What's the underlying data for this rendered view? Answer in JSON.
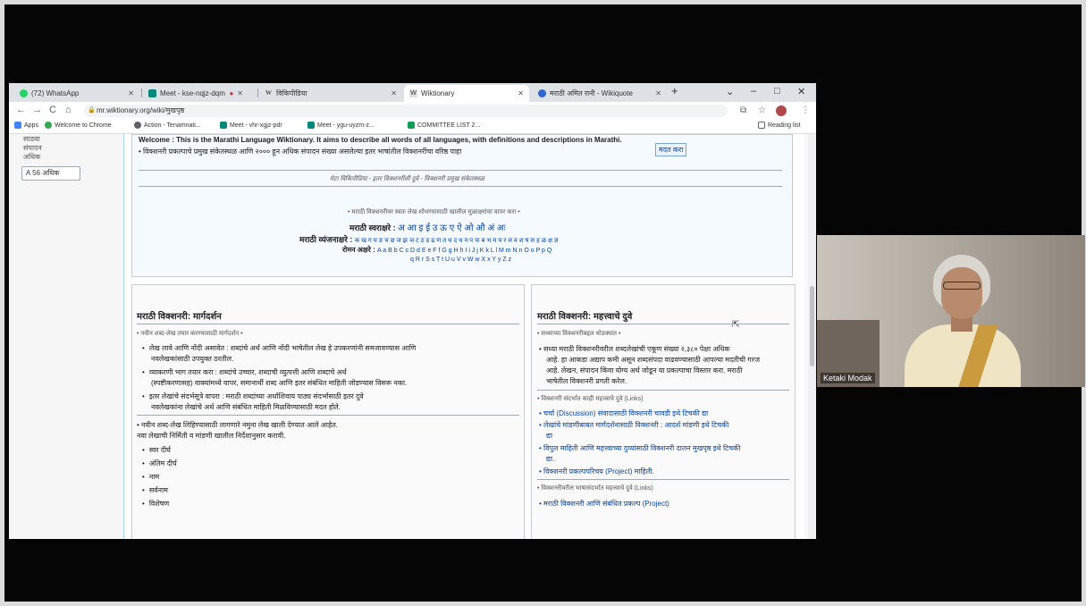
{
  "browser": {
    "tabs": [
      {
        "label": "(72) WhatsApp",
        "icon": "whatsapp-icon",
        "color": "#25d366"
      },
      {
        "label": "Meet - kse-nqjz-dqm",
        "icon": "meet-icon",
        "color": "#00897b"
      },
      {
        "label": "",
        "icon": "recording-icon",
        "color": "#d93025"
      },
      {
        "label": "विकिपीडिया",
        "icon": "wikipedia-icon",
        "color": "#555555"
      },
      {
        "label": "Wiktionary",
        "icon": "wiktionary-icon",
        "color": "#555555"
      },
      {
        "label": "मराठी अमित रानी - Wikiquote",
        "icon": "wikiquote-icon",
        "color": "#3366cc"
      }
    ],
    "new_tab": "+",
    "window_controls": {
      "dropdown": "⌄",
      "minimize": "–",
      "maximize": "□",
      "close": "✕"
    },
    "nav": {
      "back": "←",
      "forward": "→",
      "reload": "C",
      "home": "⌂"
    },
    "url": "mr.wiktionary.org/wiki/मुखपृष्ठ",
    "bookmarks": [
      {
        "label": "Apps",
        "icon": "apps-grid-icon",
        "color": "#4285f4"
      },
      {
        "label": "Welcome to Chrome",
        "icon": "chrome-icon",
        "color": "#34a853"
      },
      {
        "label": "Action - Tenamnati...",
        "icon": "bookmark-icon",
        "color": "#5f6368"
      },
      {
        "label": "Meet - vhr-xgjz-pdr",
        "icon": "meet-icon",
        "color": "#00897b"
      },
      {
        "label": "Meet - ygu-uyzm-z...",
        "icon": "meet-icon",
        "color": "#00897b"
      },
      {
        "label": "COMMITTEE LIST 2...",
        "icon": "sheets-icon",
        "color": "#0f9d58"
      }
    ],
    "reading_list": "Reading list"
  },
  "leftnav": {
    "items": [
      "साठवा",
      "संपादन",
      "अधिक"
    ],
    "lang_button": "A 56 अधिक"
  },
  "page": {
    "welcome_line": "Welcome : This is the Marathi Language Wiktionary. It aims to describe all words of all languages, with definitions and descriptions in Marathi.",
    "intro_line": "• विक्शनरी प्रकल्पाचे प्रमुख संकेतस्थळ आणि २००० हून अधिक संपादन संख्या असलेल्या इतर भाषांतील विक्शनरींचा वरिष्ठ पाहा",
    "cta": "मदत करा",
    "sister_line": "मेटा विकिपीडिया - इतर विक्शनरींशी दुवे - विक्शनरी प्रमुख संकेतस्थळ",
    "font_note": "• मराठी विक्शनरीवर स्वतः लेख शोधण्यासाठी खालील मुळाक्षरांचा वापर करा •",
    "vowels_label": "मराठी स्वराक्षरे :",
    "vowels": "अ आ इ ई उ ऊ ए ऐ ओ औ अं अः",
    "consonants_label": "मराठी व्यंजनाक्षरे :",
    "consonants": "क ख ग घ ङ च छ ज झ ञ ट ठ ड ढ ण त थ द ध न प फ ब भ म य र ल व श ष स ह ळ क्ष ज्ञ",
    "roman_label": "रोमन अक्षरे :",
    "roman_line1": "A a B b C c D d E e F f G g H h I i J j K k L l M m N n O o P p Q",
    "roman_line2": "q R r S s T t U u V v W w X x Y y Z z"
  },
  "left_section": {
    "title": "मराठी विक्शनरी: मार्गदर्शन",
    "subtitle": "• नवीन शब्द-लेख तयार करण्यासाठी मार्गदर्शन •",
    "bullets": [
      "लेख लावे आणि नोंदी असावेत : शब्दांचे अर्थ आणि नोंदी भाषेतील लेख हे उपकरणांनी समजावण्यास आणि",
      "नवलेखकांसाठी उपयुक्त ठरतील.",
      "व्याकरणी भाग तयार करा : शब्दांचे उच्चार, शब्दाची व्युत्पत्ती आणि शब्दाचे अर्थ",
      "(स्पष्टीकरणासह) वाक्यांमध्ये वापर, समानार्थी शब्द आणि इतर संबंधित माहिती जोडण्यास विसरू नका.",
      "इतर लेखांचे संदर्भसूत्रे वापरा : मराठी शब्दांच्या अर्थाशिवाय पाठ्य संदर्भासाठी इतर दुवे",
      "नवलेखकांना लेखांचे अर्थ आणि संबंधित माहिती मिळविण्यासाठी मदत होते."
    ],
    "note1": "• नवीन शब्द-लेख लिहिण्यासाठी लागणारे नमुना लेख खाली देण्यात आले आहेत.",
    "note2": "नवा लेखाची निर्मिती व मांडणी खालील निर्देशानुसार करावी.",
    "list": [
      "स्वर दीर्घ",
      "अंतिम दीर्घ",
      "नाम",
      "सर्वनाम",
      "विशेषण"
    ]
  },
  "right_section": {
    "title": "मराठी विक्शनरी: महत्त्वाचे दुवे",
    "subtitle": "• सध्याच्या विक्शनरीबद्दल थोडक्यात •",
    "para": [
      "• सध्या मराठी विक्शनरीवरील शब्दलेखांची एकूण संख्या २,३८० पेक्षा अधिक",
      "आहे. हा आकडा अद्याप कमी असून शब्दसंपदा वाढवण्यासाठी आपल्या मदतीची गरज",
      "आहे. लेखन, संपादन किंवा योग्य अर्थ जोडून या प्रकल्पाचा विस्तार करा. मराठी",
      "भाषेतील विक्शनरी प्रगती करेल."
    ],
    "links_head": "• विक्शनरी संदर्भात काही महत्त्वाचे दुवे (Links)",
    "links": [
      "• चर्चा (Discussion) संवादासाठी विक्शनरी चावडी इथे टिचकी द्या",
      "• लेखांचे मांडणीबाबत मार्गदर्शनासाठी विक्शनरी : आदर्श मांडणी इथे टिचकी",
      "द्या",
      "• विपुल माहिती आणि महत्त्वाच्या दुव्यांसाठी विक्शनरी दालन मुखपृष्ठ इथे टिचकी",
      "द्या.",
      "• विक्शनरी प्रकल्पपरिचय (Project) माहिती."
    ],
    "links_head2": "• विक्शनरीवरील भाषासंदर्भात महत्त्वाचे दुवे (Links)",
    "partial": "• मराठी विक्शनरी आणि संबंधित प्रकल्प (Project)"
  },
  "webcam": {
    "name": "Ketaki Modak"
  }
}
